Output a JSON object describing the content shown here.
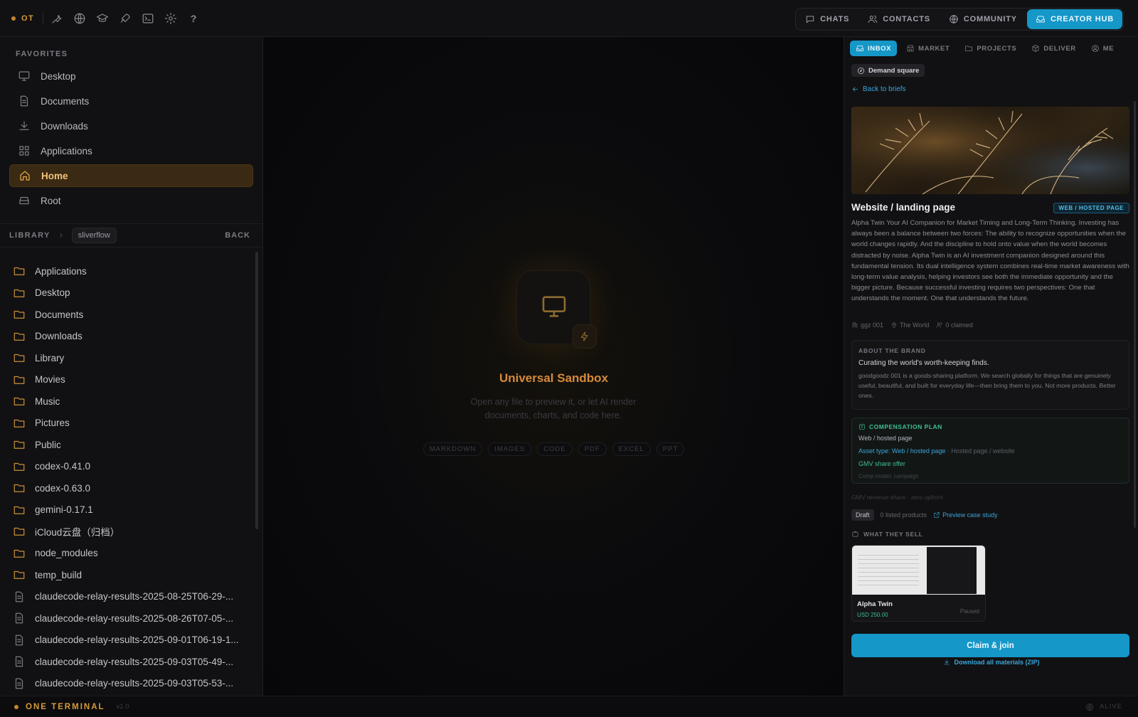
{
  "topbar": {
    "brand": "OT",
    "tools": [
      "wrench-icon",
      "globe-icon",
      "graduation-cap-icon",
      "rocket-icon",
      "terminal-icon",
      "gear-icon"
    ],
    "help": "?",
    "nav": {
      "chats": "CHATS",
      "contacts": "CONTACTS",
      "community": "COMMUNITY",
      "creator_hub": "CREATOR HUB"
    }
  },
  "sidebar": {
    "favorites_title": "FAVORITES",
    "favorites": [
      {
        "label": "Desktop",
        "icon": "monitor-icon"
      },
      {
        "label": "Documents",
        "icon": "document-icon"
      },
      {
        "label": "Downloads",
        "icon": "download-icon"
      },
      {
        "label": "Applications",
        "icon": "grid-icon"
      },
      {
        "label": "Home",
        "icon": "home-icon",
        "selected": true
      },
      {
        "label": "Root",
        "icon": "drive-icon"
      }
    ],
    "library_label": "LIBRARY",
    "library_chip": "sliverflow",
    "back": "BACK",
    "files": [
      {
        "name": "Applications",
        "type": "folder"
      },
      {
        "name": "Desktop",
        "type": "folder"
      },
      {
        "name": "Documents",
        "type": "folder"
      },
      {
        "name": "Downloads",
        "type": "folder"
      },
      {
        "name": "Library",
        "type": "folder"
      },
      {
        "name": "Movies",
        "type": "folder"
      },
      {
        "name": "Music",
        "type": "folder"
      },
      {
        "name": "Pictures",
        "type": "folder"
      },
      {
        "name": "Public",
        "type": "folder"
      },
      {
        "name": "codex-0.41.0",
        "type": "folder"
      },
      {
        "name": "codex-0.63.0",
        "type": "folder"
      },
      {
        "name": "gemini-0.17.1",
        "type": "folder"
      },
      {
        "name": "iCloud云盘（归档）",
        "type": "folder"
      },
      {
        "name": "node_modules",
        "type": "folder"
      },
      {
        "name": "temp_build",
        "type": "folder"
      },
      {
        "name": "claudecode-relay-results-2025-08-25T06-29-...",
        "type": "file"
      },
      {
        "name": "claudecode-relay-results-2025-08-26T07-05-...",
        "type": "file"
      },
      {
        "name": "claudecode-relay-results-2025-09-01T06-19-1...",
        "type": "file"
      },
      {
        "name": "claudecode-relay-results-2025-09-03T05-49-...",
        "type": "file"
      },
      {
        "name": "claudecode-relay-results-2025-09-03T05-53-...",
        "type": "file"
      }
    ]
  },
  "sandbox": {
    "title": "Universal Sandbox",
    "subtitle": "Open any file to preview it, or let AI render documents, charts, and code here.",
    "tags": [
      "MARKDOWN",
      "IMAGES",
      "CODE",
      "PDF",
      "EXCEL",
      "PPT"
    ]
  },
  "right_panel": {
    "tabs": [
      {
        "label": "INBOX",
        "icon": "inbox-icon",
        "active": true
      },
      {
        "label": "MARKET",
        "icon": "store-icon"
      },
      {
        "label": "PROJECTS",
        "icon": "folder-icon"
      },
      {
        "label": "DELIVER",
        "icon": "package-icon"
      },
      {
        "label": "ME",
        "icon": "user-circle-icon"
      }
    ],
    "demand_chip": "Demand square",
    "back_link": "Back to briefs",
    "brief_title": "Website / landing page",
    "brief_badge": "WEB / HOSTED PAGE",
    "description": "Alpha Twin Your AI Companion for Market Timing and Long-Term Thinking. Investing has always been a balance between two forces: The ability to recognize opportunities when the world changes rapidly. And the discipline to hold onto value when the world becomes distracted by noise. Alpha Twin is an AI investment companion designed around this fundamental tension. Its dual intelligence system combines real-time market awareness with long-term value analysis, helping investors see both the immediate opportunity and the bigger picture. Because successful investing requires two perspectives: One that understands the moment. One that understands the future.",
    "meta": {
      "company": "ggz 001",
      "location": "The World",
      "claimed": "0 claimed"
    },
    "about": {
      "heading": "ABOUT THE BRAND",
      "tagline": "Curating the world's worth-keeping finds.",
      "body": "goodgoodz 001 is a goods-sharing platform. We search globally for things that are genuinely useful, beautiful, and built for everyday life—then bring them to you. Not more products. Better ones."
    },
    "compensation": {
      "heading": "COMPENSATION PLAN",
      "line1": "Web / hosted page",
      "asset_type": "Asset type: Web / hosted page",
      "asset_extra": "· Hosted page / website",
      "offer": "GMV share offer",
      "model": "Comp model: campaign"
    },
    "gmv_note": "GMV revenue share · zero upfront",
    "status": {
      "draft": "Draft",
      "listed": "0 listed products",
      "preview": "Preview case study"
    },
    "what_they_sell": "WHAT THEY SELL",
    "product": {
      "name": "Alpha Twin",
      "price": "USD 250.00",
      "status": "Paused"
    },
    "claim_button": "Claim & join",
    "download": "Download all materials (ZIP)"
  },
  "statusbar": {
    "name": "ONE TERMINAL",
    "version": "v1.0",
    "state": "ALIVE"
  },
  "colors": {
    "accent": "#1597c8",
    "brand": "#d59a37",
    "selected_bg": "#3b2a13",
    "success": "#3fbf93"
  }
}
